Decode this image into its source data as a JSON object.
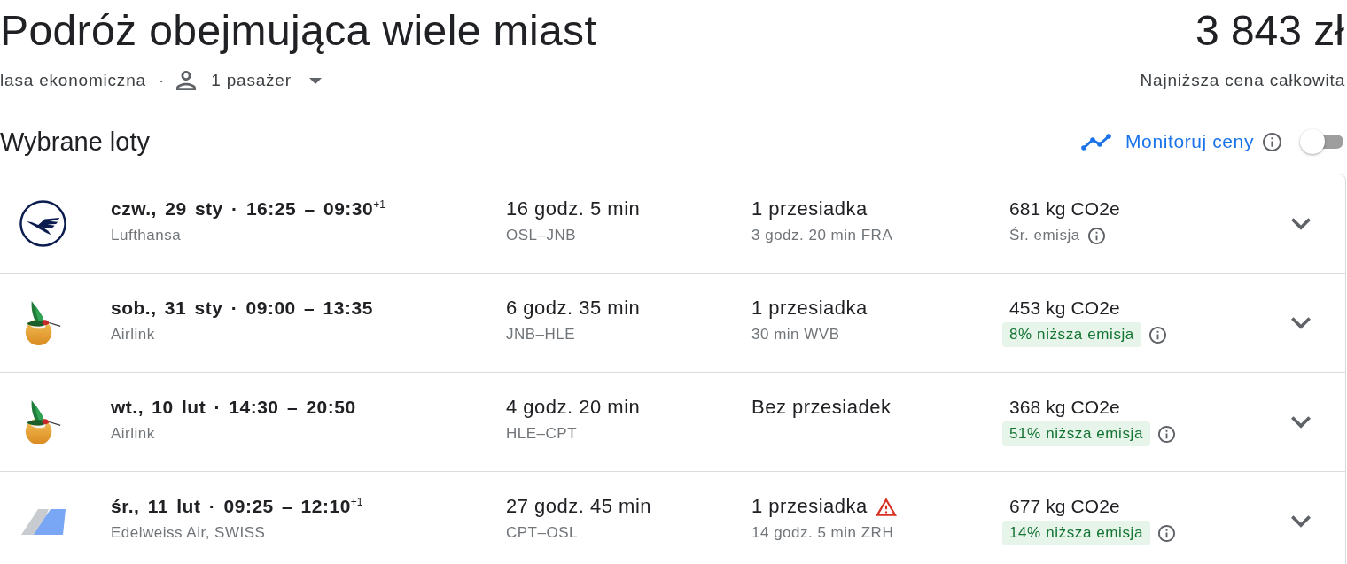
{
  "header": {
    "title": "Podróż obejmująca wiele miast",
    "price": "3 843 zł",
    "cabin_class": "lasa ekonomiczna",
    "separator": "·",
    "passengers": "1 pasażer",
    "price_caption": "Najniższa cena całkowita"
  },
  "selected_flights": {
    "heading": "Wybrane loty",
    "price_tracking": {
      "label": "Monitoruj ceny",
      "on": false
    },
    "flights": [
      {
        "logo": {
          "kind": "crane"
        },
        "times": "czw., 29 sty · 16:25 – 09:30$^{+1}$",
        "airline": "Lufthansa",
        "duration": "16 godz. 5 min",
        "route": "OSL–JNB",
        "stops": "1 przesiadka",
        "stop_details": "3 godz. 20 min FRA",
        "warning": false,
        "emissions": "681 kg CO2e",
        "emission_note": {
          "kind": "average",
          "text": "Śr. emisja"
        }
      },
      {
        "logo": {
          "kind": "hummingbird"
        },
        "times": "sob., 31 sty · 09:00 – 13:35",
        "airline": "Airlink",
        "duration": "6 godz. 35 min",
        "route": "JNB–HLE",
        "stops": "1 przesiadka",
        "stop_details": "30 min WVB",
        "warning": false,
        "emissions": "453 kg CO2e",
        "emission_note": {
          "kind": "lower",
          "text": "8% niższa emisja"
        }
      },
      {
        "logo": {
          "kind": "hummingbird"
        },
        "times": "wt., 10 lut · 14:30 – 20:50",
        "airline": "Airlink",
        "duration": "4 godz. 20 min",
        "route": "HLE–CPT",
        "stops": "Bez przesiadek",
        "warning": false,
        "emissions": "368 kg CO2e",
        "emission_note": {
          "kind": "lower",
          "text": "51% niższa emisja"
        }
      },
      {
        "logo": {
          "kind": "tailfin"
        },
        "times": "śr., 11 lut · 09:25 – 12:10$^{+1}$",
        "airline": "Edelweiss Air, SWISS",
        "duration": "27 godz. 45 min",
        "route": "CPT–OSL",
        "stops": "1 przesiadka",
        "stop_details": "14 godz. 5 min ZRH",
        "warning": true,
        "emissions": "677 kg CO2e",
        "emission_note": {
          "kind": "lower",
          "text": "14% niższa emisja"
        }
      }
    ]
  }
}
